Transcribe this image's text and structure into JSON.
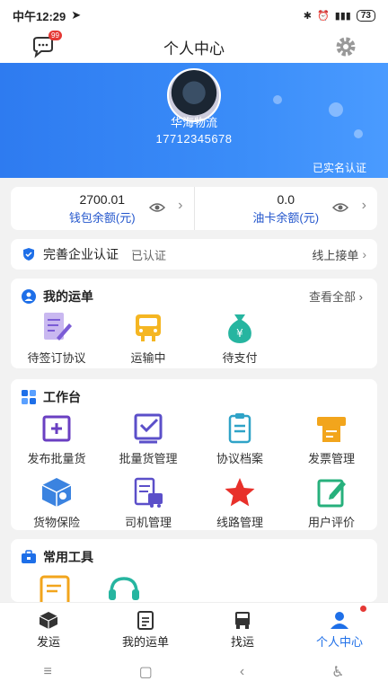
{
  "status": {
    "time": "中午12:29",
    "battery": "73"
  },
  "header": {
    "title": "个人中心",
    "msg_badge": "99"
  },
  "profile": {
    "company": "华海物流",
    "phone": "17712345678",
    "verified": "已实名认证"
  },
  "wallet": {
    "balance_value": "2700.01",
    "balance_label": "钱包余额(元)",
    "fuel_value": "0.0",
    "fuel_label": "油卡余额(元)"
  },
  "cert": {
    "title": "完善企业认证",
    "status": "已认证",
    "link": "线上接单"
  },
  "orders": {
    "title": "我的运单",
    "more": "查看全部",
    "items": [
      {
        "label": "待签订协议"
      },
      {
        "label": "运输中"
      },
      {
        "label": "待支付"
      }
    ]
  },
  "workbench": {
    "title": "工作台",
    "items": [
      {
        "label": "发布批量货"
      },
      {
        "label": "批量货管理"
      },
      {
        "label": "协议档案"
      },
      {
        "label": "发票管理"
      },
      {
        "label": "货物保险"
      },
      {
        "label": "司机管理"
      },
      {
        "label": "线路管理"
      },
      {
        "label": "用户评价"
      }
    ]
  },
  "tools": {
    "title": "常用工具"
  },
  "tabs": [
    {
      "label": "发运"
    },
    {
      "label": "我的运单"
    },
    {
      "label": "找运"
    },
    {
      "label": "个人中心"
    }
  ],
  "colors": {
    "accent": "#1e6fe8",
    "banner": "#3a8cf8",
    "badge": "#e53935"
  }
}
